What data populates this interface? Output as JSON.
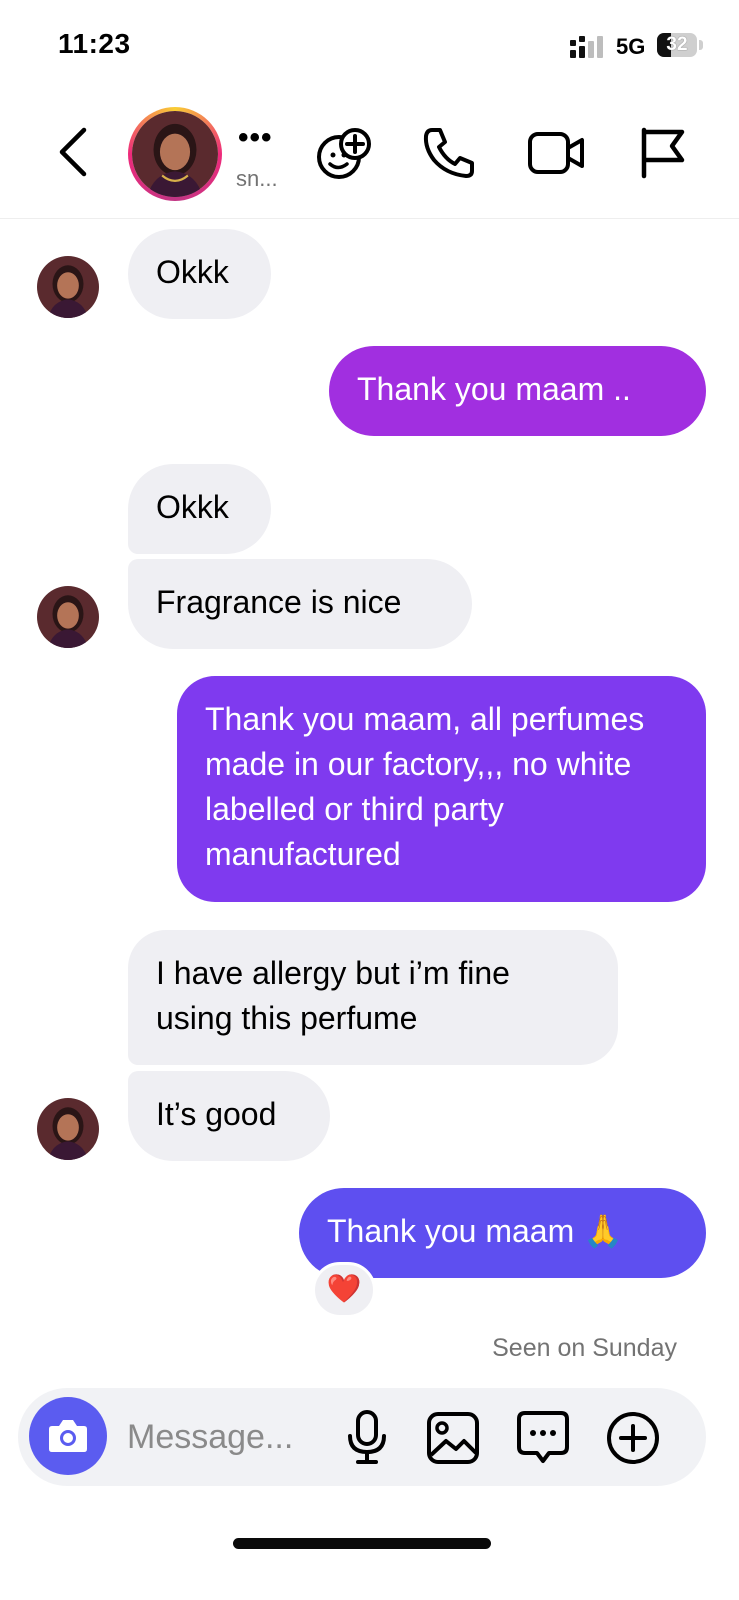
{
  "status_bar": {
    "time": "11:23",
    "network": "5G",
    "battery": "32",
    "icons": [
      "signal-icon",
      "battery-icon"
    ]
  },
  "header": {
    "more": "•••",
    "username": "sn...",
    "icons": [
      "back-chevron-icon",
      "add-people-icon",
      "phone-icon",
      "video-camera-icon",
      "flag-icon"
    ]
  },
  "messages": [
    {
      "from": "them",
      "text": "Okkk"
    },
    {
      "from": "me",
      "text": "Thank you maam .."
    },
    {
      "from": "them",
      "text": "Okkk"
    },
    {
      "from": "them",
      "text": "Fragrance is nice"
    },
    {
      "from": "me",
      "text": "Thank you maam, all perfumes made in our factory,,, no white labelled or third party manufactured"
    },
    {
      "from": "them",
      "text": "I have allergy but i’m fine using this perfume"
    },
    {
      "from": "them",
      "text": "It’s good"
    },
    {
      "from": "me",
      "text": "Thank you maam 🙏"
    }
  ],
  "reaction": "❤️",
  "seen": "Seen on Sunday",
  "composer": {
    "placeholder": "Message...",
    "icons": [
      "camera-icon",
      "microphone-icon",
      "gallery-icon",
      "sticker-icon",
      "plus-icon"
    ]
  },
  "colors": {
    "incoming_bubble": "#efeff3",
    "outgoing_1": "#a12fe0",
    "outgoing_2": "#7f3aef",
    "outgoing_3": "#5e4ff0",
    "camera_button": "#5b5cf0",
    "story_ring": "#ee2a7b"
  }
}
